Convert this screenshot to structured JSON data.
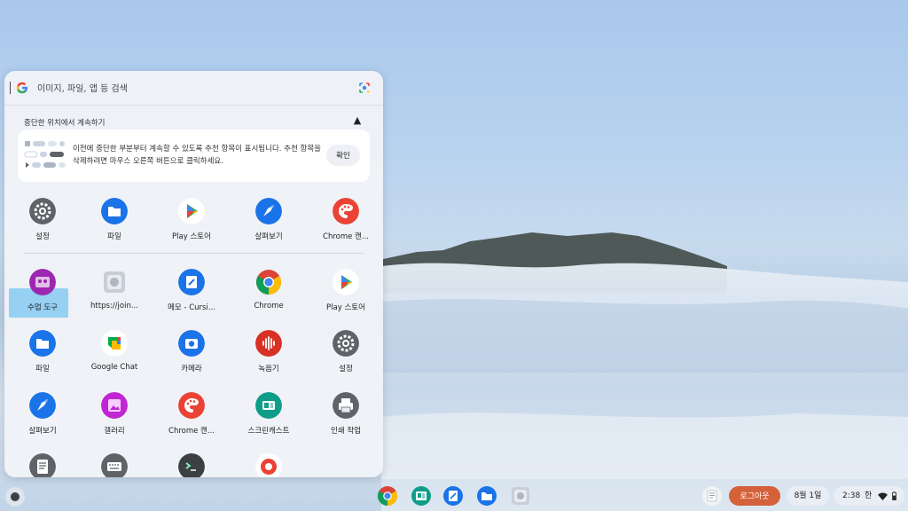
{
  "search": {
    "placeholder": "이미지, 파일, 앱 등 검색"
  },
  "continue": {
    "title": "중단한 위치에서 계속하기",
    "card_text": "이전에 중단한 부분부터 계속할 수 있도록 추천 항목이 표시됩니다. 추천 항목을 삭제하려면 마우스 오른쪽 버튼으로 클릭하세요.",
    "ok_label": "확인"
  },
  "recent_apps": [
    {
      "label": "설정",
      "icon": "settings-icon",
      "color": "#5f6368"
    },
    {
      "label": "파일",
      "icon": "files-icon",
      "color": "#1a73e8"
    },
    {
      "label": "Play 스토어",
      "icon": "play-store-icon",
      "color": "#ffffff"
    },
    {
      "label": "살펴보기",
      "icon": "explore-icon",
      "color": "#1a73e8"
    },
    {
      "label": "Chrome 캔...",
      "icon": "chrome-canvas-icon",
      "color": "#ea4335"
    }
  ],
  "apps": [
    {
      "label": "수업 도구",
      "icon": "class-tools-icon",
      "color": "#9c27b0"
    },
    {
      "label": "https://join...",
      "icon": "web-app-icon",
      "color": "#c9ced6"
    },
    {
      "label": "메모 - Cursi...",
      "icon": "cursive-icon",
      "color": "#1a73e8"
    },
    {
      "label": "Chrome",
      "icon": "chrome-icon",
      "color": "#4285f4"
    },
    {
      "label": "Play 스토어",
      "icon": "play-store-icon",
      "color": "#ffffff"
    },
    {
      "label": "파일",
      "icon": "files-icon",
      "color": "#1a73e8"
    },
    {
      "label": "Google Chat",
      "icon": "google-chat-icon",
      "color": "#ffffff"
    },
    {
      "label": "카메라",
      "icon": "camera-icon",
      "color": "#1a73e8"
    },
    {
      "label": "녹음기",
      "icon": "recorder-icon",
      "color": "#d93025"
    },
    {
      "label": "설정",
      "icon": "settings-icon",
      "color": "#5f6368"
    },
    {
      "label": "살펴보기",
      "icon": "explore-icon",
      "color": "#1a73e8"
    },
    {
      "label": "갤러리",
      "icon": "gallery-icon",
      "color": "#c026d3"
    },
    {
      "label": "Chrome 캔...",
      "icon": "chrome-canvas-icon",
      "color": "#ea4335"
    },
    {
      "label": "스크린캐스트",
      "icon": "screencast-icon",
      "color": "#0f9d8a"
    },
    {
      "label": "인쇄 작업",
      "icon": "print-jobs-icon",
      "color": "#5f6368"
    },
    {
      "label": "",
      "icon": "docs-icon",
      "color": "#5f6368"
    },
    {
      "label": "",
      "icon": "keyboard-icon",
      "color": "#5f6368"
    },
    {
      "label": "",
      "icon": "terminal-icon",
      "color": "#3c4043"
    },
    {
      "label": "",
      "icon": "chrome-beta-icon",
      "color": "#ffffff"
    }
  ],
  "shelf": {
    "pinned": [
      "chrome-icon",
      "classroom-icon",
      "cursive-icon",
      "files-icon",
      "web-app-icon"
    ],
    "logout_label": "로그아웃",
    "date": "8월 1일",
    "time": "2:38",
    "ime": "한"
  }
}
